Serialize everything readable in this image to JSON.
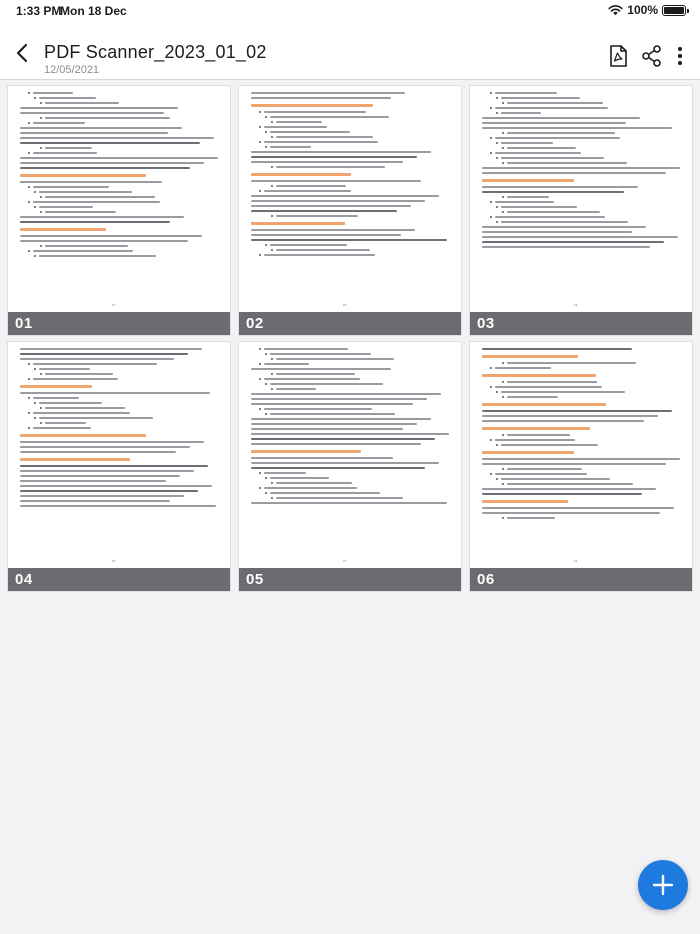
{
  "status_bar": {
    "time": "1:33 PM",
    "date": "Mon 18 Dec",
    "battery": "100%",
    "battery_level": 1.0
  },
  "header": {
    "back_icon": "chevron-left-icon",
    "title": "PDF Scanner_2023_01_02",
    "date": "12/05/2021",
    "actions": [
      {
        "name": "pdf-export-button",
        "icon": "pdf-icon"
      },
      {
        "name": "share-button",
        "icon": "share-icon"
      },
      {
        "name": "more-options-button",
        "icon": "more-vertical-icon"
      }
    ]
  },
  "pages": [
    {
      "number": "01",
      "page_label": "17"
    },
    {
      "number": "02",
      "page_label": "18"
    },
    {
      "number": "03",
      "page_label": "19"
    },
    {
      "number": "04",
      "page_label": "20"
    },
    {
      "number": "05",
      "page_label": "21"
    },
    {
      "number": "06",
      "page_label": "22"
    }
  ],
  "fab": {
    "icon": "plus-icon"
  },
  "colors": {
    "accent": "#1f7ae0",
    "footer": "#6b6b70",
    "heading_text": "#f0a470",
    "background": "#f2f2f4"
  }
}
